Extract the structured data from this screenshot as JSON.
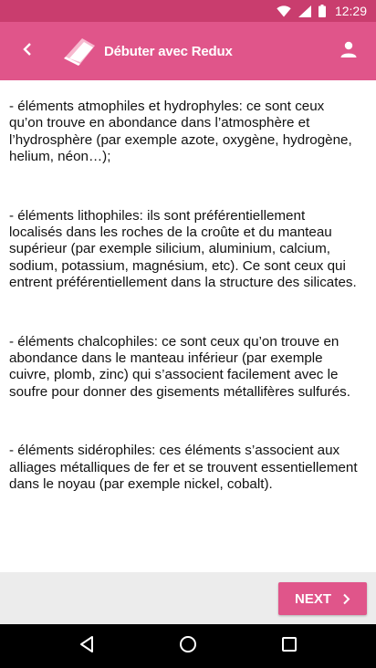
{
  "status_bar": {
    "time": "12:29",
    "icons": [
      "wifi-icon",
      "signal-icon",
      "battery-icon"
    ]
  },
  "app_bar": {
    "title": "Débuter avec Redux",
    "back_icon": "chevron-left-icon",
    "logo_icon": "book-logo-icon",
    "profile_icon": "person-icon",
    "color": "#e0558a"
  },
  "content": {
    "paragraphs": [
      "- éléments atmophiles et hydrophyles: ce sont ceux qu’on trouve en abondance dans l’atmosphère et l’hydrosphère (par exemple azote, oxygène, hydrogène, helium, néon…);",
      "- éléments lithophiles: ils sont préférentiellement localisés dans les roches de la croûte et du manteau supérieur (par exemple silicium, aluminium, calcium, sodium, potassium, magnésium, etc). Ce sont ceux qui entrent préférentiellement dans la structure des silicates.",
      "- éléments chalcophiles: ce sont ceux qu’on trouve en abondance dans le manteau inférieur (par exemple cuivre, plomb, zinc) qui s’associent facilement avec le soufre pour donner des gisements métallifères sulfurés.",
      "- éléments sidérophiles: ces éléments s’associent aux alliages métalliques de fer et se trouvent essentiellement dans le noyau (par exemple nickel, cobalt)."
    ]
  },
  "footer": {
    "next_label": "NEXT",
    "next_icon": "chevron-right-icon"
  },
  "nav_bar": {
    "icons": [
      "back-triangle-icon",
      "home-circle-icon",
      "recents-square-icon"
    ]
  }
}
